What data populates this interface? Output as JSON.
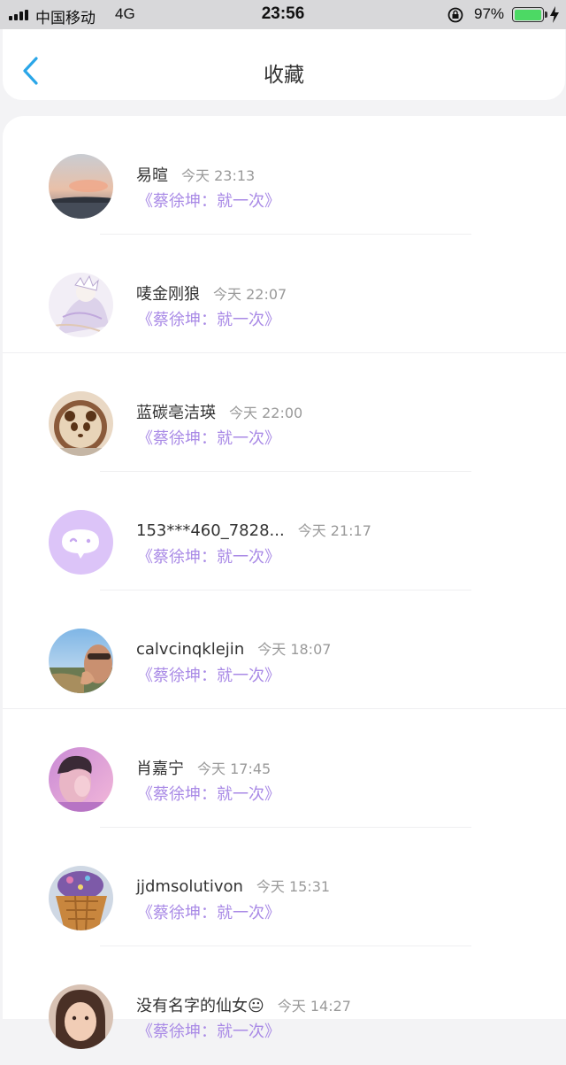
{
  "status_bar": {
    "carrier": "中国移动",
    "network": "4G",
    "time": "23:56",
    "battery_percent": "97%",
    "battery_level": 0.97,
    "colors": {
      "battery": "#4cd964"
    }
  },
  "nav": {
    "title": "收藏",
    "back_icon": "chevron-left-icon",
    "accent": "#2aa6e8"
  },
  "list": [
    {
      "name": "易暄",
      "time": "今天 23:13",
      "quote": "《蔡徐坤：就一次》",
      "avatar": "sunset-landscape"
    },
    {
      "name": "唛金刚狼",
      "time": "今天 22:07",
      "quote": "《蔡徐坤：就一次》",
      "avatar": "anime-character"
    },
    {
      "name": "蓝碳亳洁瑛",
      "time": "今天 22:00",
      "quote": "《蔡徐坤：就一次》",
      "avatar": "panda-latte"
    },
    {
      "name": "153***460_7828...",
      "time": "今天 21:17",
      "quote": "《蔡徐坤：就一次》",
      "avatar": "default-chat"
    },
    {
      "name": "calvcinqklejin",
      "time": "今天 18:07",
      "quote": "《蔡徐坤：就一次》",
      "avatar": "person-outdoor"
    },
    {
      "name": "肖嘉宁",
      "time": "今天 17:45",
      "quote": "《蔡徐坤：就一次》",
      "avatar": "pink-portrait"
    },
    {
      "name": "jjdmsolutivon",
      "time": "今天 15:31",
      "quote": "《蔡徐坤：就一次》",
      "avatar": "waffle-cone"
    },
    {
      "name": "没有名字的仙女😐",
      "time": "今天 14:27",
      "quote": "《蔡徐坤：就一次》",
      "avatar": "girl-portrait"
    }
  ],
  "colors": {
    "quote": "#a98ae6",
    "time": "#9a9a9a",
    "default_avatar": "#dcc4f8"
  }
}
